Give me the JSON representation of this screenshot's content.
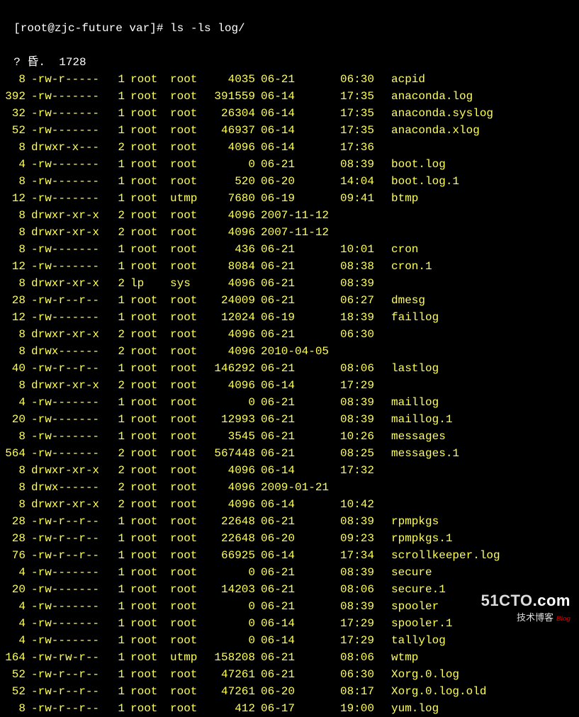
{
  "prompt": {
    "full": "[root@zjc-future var]# ls -ls log/"
  },
  "summary": "? 昏.  1728",
  "rows": [
    {
      "blocks": "8",
      "perms": "-rw-r-----",
      "links": "1",
      "owner": "root",
      "group": "root",
      "size": "4035",
      "date": "06-21",
      "time": "06:30",
      "name": "acpid"
    },
    {
      "blocks": "392",
      "perms": "-rw-------",
      "links": "1",
      "owner": "root",
      "group": "root",
      "size": "391559",
      "date": "06-14",
      "time": "17:35",
      "name": "anaconda.log"
    },
    {
      "blocks": "32",
      "perms": "-rw-------",
      "links": "1",
      "owner": "root",
      "group": "root",
      "size": "26304",
      "date": "06-14",
      "time": "17:35",
      "name": "anaconda.syslog"
    },
    {
      "blocks": "52",
      "perms": "-rw-------",
      "links": "1",
      "owner": "root",
      "group": "root",
      "size": "46937",
      "date": "06-14",
      "time": "17:35",
      "name": "anaconda.xlog"
    },
    {
      "blocks": "8",
      "perms": "drwxr-x---",
      "links": "2",
      "owner": "root",
      "group": "root",
      "size": "4096",
      "date": "06-14",
      "time": "17:36",
      "name": ""
    },
    {
      "blocks": "4",
      "perms": "-rw-------",
      "links": "1",
      "owner": "root",
      "group": "root",
      "size": "0",
      "date": "06-21",
      "time": "08:39",
      "name": "boot.log"
    },
    {
      "blocks": "8",
      "perms": "-rw-------",
      "links": "1",
      "owner": "root",
      "group": "root",
      "size": "520",
      "date": "06-20",
      "time": "14:04",
      "name": "boot.log.1"
    },
    {
      "blocks": "12",
      "perms": "-rw-------",
      "links": "1",
      "owner": "root",
      "group": "utmp",
      "size": "7680",
      "date": "06-19",
      "time": "09:41",
      "name": "btmp"
    },
    {
      "blocks": "8",
      "perms": "drwxr-xr-x",
      "links": "2",
      "owner": "root",
      "group": "root",
      "size": "4096",
      "date": "2007-11-12",
      "time": "",
      "name": ""
    },
    {
      "blocks": "8",
      "perms": "drwxr-xr-x",
      "links": "2",
      "owner": "root",
      "group": "root",
      "size": "4096",
      "date": "2007-11-12",
      "time": "",
      "name": ""
    },
    {
      "blocks": "8",
      "perms": "-rw-------",
      "links": "1",
      "owner": "root",
      "group": "root",
      "size": "436",
      "date": "06-21",
      "time": "10:01",
      "name": "cron"
    },
    {
      "blocks": "12",
      "perms": "-rw-------",
      "links": "1",
      "owner": "root",
      "group": "root",
      "size": "8084",
      "date": "06-21",
      "time": "08:38",
      "name": "cron.1"
    },
    {
      "blocks": "8",
      "perms": "drwxr-xr-x",
      "links": "2",
      "owner": "lp",
      "group": "sys",
      "size": "4096",
      "date": "06-21",
      "time": "08:39",
      "name": ""
    },
    {
      "blocks": "28",
      "perms": "-rw-r--r--",
      "links": "1",
      "owner": "root",
      "group": "root",
      "size": "24009",
      "date": "06-21",
      "time": "06:27",
      "name": "dmesg"
    },
    {
      "blocks": "12",
      "perms": "-rw-------",
      "links": "1",
      "owner": "root",
      "group": "root",
      "size": "12024",
      "date": "06-19",
      "time": "18:39",
      "name": "faillog"
    },
    {
      "blocks": "8",
      "perms": "drwxr-xr-x",
      "links": "2",
      "owner": "root",
      "group": "root",
      "size": "4096",
      "date": "06-21",
      "time": "06:30",
      "name": ""
    },
    {
      "blocks": "8",
      "perms": "drwx------",
      "links": "2",
      "owner": "root",
      "group": "root",
      "size": "4096",
      "date": "2010-04-05",
      "time": "",
      "name": ""
    },
    {
      "blocks": "40",
      "perms": "-rw-r--r--",
      "links": "1",
      "owner": "root",
      "group": "root",
      "size": "146292",
      "date": "06-21",
      "time": "08:06",
      "name": "lastlog"
    },
    {
      "blocks": "8",
      "perms": "drwxr-xr-x",
      "links": "2",
      "owner": "root",
      "group": "root",
      "size": "4096",
      "date": "06-14",
      "time": "17:29",
      "name": ""
    },
    {
      "blocks": "4",
      "perms": "-rw-------",
      "links": "1",
      "owner": "root",
      "group": "root",
      "size": "0",
      "date": "06-21",
      "time": "08:39",
      "name": "maillog"
    },
    {
      "blocks": "20",
      "perms": "-rw-------",
      "links": "1",
      "owner": "root",
      "group": "root",
      "size": "12993",
      "date": "06-21",
      "time": "08:39",
      "name": "maillog.1"
    },
    {
      "blocks": "8",
      "perms": "-rw-------",
      "links": "1",
      "owner": "root",
      "group": "root",
      "size": "3545",
      "date": "06-21",
      "time": "10:26",
      "name": "messages"
    },
    {
      "blocks": "564",
      "perms": "-rw-------",
      "links": "2",
      "owner": "root",
      "group": "root",
      "size": "567448",
      "date": "06-21",
      "time": "08:25",
      "name": "messages.1"
    },
    {
      "blocks": "8",
      "perms": "drwxr-xr-x",
      "links": "2",
      "owner": "root",
      "group": "root",
      "size": "4096",
      "date": "06-14",
      "time": "17:32",
      "name": ""
    },
    {
      "blocks": "8",
      "perms": "drwx------",
      "links": "2",
      "owner": "root",
      "group": "root",
      "size": "4096",
      "date": "2009-01-21",
      "time": "",
      "name": ""
    },
    {
      "blocks": "8",
      "perms": "drwxr-xr-x",
      "links": "2",
      "owner": "root",
      "group": "root",
      "size": "4096",
      "date": "06-14",
      "time": "10:42",
      "name": ""
    },
    {
      "blocks": "28",
      "perms": "-rw-r--r--",
      "links": "1",
      "owner": "root",
      "group": "root",
      "size": "22648",
      "date": "06-21",
      "time": "08:39",
      "name": "rpmpkgs"
    },
    {
      "blocks": "28",
      "perms": "-rw-r--r--",
      "links": "1",
      "owner": "root",
      "group": "root",
      "size": "22648",
      "date": "06-20",
      "time": "09:23",
      "name": "rpmpkgs.1"
    },
    {
      "blocks": "76",
      "perms": "-rw-r--r--",
      "links": "1",
      "owner": "root",
      "group": "root",
      "size": "66925",
      "date": "06-14",
      "time": "17:34",
      "name": "scrollkeeper.log"
    },
    {
      "blocks": "4",
      "perms": "-rw-------",
      "links": "1",
      "owner": "root",
      "group": "root",
      "size": "0",
      "date": "06-21",
      "time": "08:39",
      "name": "secure"
    },
    {
      "blocks": "20",
      "perms": "-rw-------",
      "links": "1",
      "owner": "root",
      "group": "root",
      "size": "14203",
      "date": "06-21",
      "time": "08:06",
      "name": "secure.1"
    },
    {
      "blocks": "4",
      "perms": "-rw-------",
      "links": "1",
      "owner": "root",
      "group": "root",
      "size": "0",
      "date": "06-21",
      "time": "08:39",
      "name": "spooler"
    },
    {
      "blocks": "4",
      "perms": "-rw-------",
      "links": "1",
      "owner": "root",
      "group": "root",
      "size": "0",
      "date": "06-14",
      "time": "17:29",
      "name": "spooler.1"
    },
    {
      "blocks": "4",
      "perms": "-rw-------",
      "links": "1",
      "owner": "root",
      "group": "root",
      "size": "0",
      "date": "06-14",
      "time": "17:29",
      "name": "tallylog"
    },
    {
      "blocks": "164",
      "perms": "-rw-rw-r--",
      "links": "1",
      "owner": "root",
      "group": "utmp",
      "size": "158208",
      "date": "06-21",
      "time": "08:06",
      "name": "wtmp"
    },
    {
      "blocks": "52",
      "perms": "-rw-r--r--",
      "links": "1",
      "owner": "root",
      "group": "root",
      "size": "47261",
      "date": "06-21",
      "time": "06:30",
      "name": "Xorg.0.log"
    },
    {
      "blocks": "52",
      "perms": "-rw-r--r--",
      "links": "1",
      "owner": "root",
      "group": "root",
      "size": "47261",
      "date": "06-20",
      "time": "08:17",
      "name": "Xorg.0.log.old"
    },
    {
      "blocks": "8",
      "perms": "-rw-r--r--",
      "links": "1",
      "owner": "root",
      "group": "root",
      "size": "412",
      "date": "06-17",
      "time": "19:00",
      "name": "yum.log"
    }
  ],
  "watermark": {
    "line1_a": "51CTO",
    "line1_b": ".com",
    "line2": "技术博客",
    "blog": "Blog"
  }
}
